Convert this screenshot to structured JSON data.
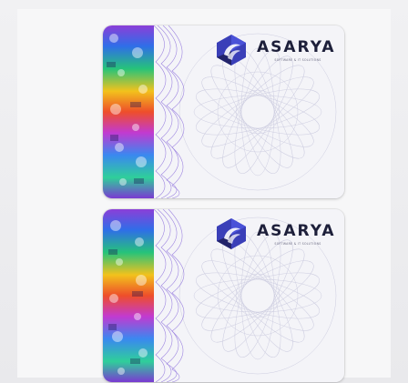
{
  "cards": [
    {
      "brand": "ASARYA",
      "tagline": "SOFTWARE & IT SOLUTIONS",
      "logo": "asarya-logo-icon"
    },
    {
      "brand": "ASARYA",
      "tagline": "SOFTWARE & IT SOLUTIONS",
      "logo": "asarya-logo-icon"
    }
  ],
  "colors": {
    "logo_blue": "#3a3fb8",
    "logo_dark": "#22236a",
    "brand_text": "#1d1f3a",
    "guilloche_line": "#c9c9d8",
    "hologram_purple": "#6b3fd1"
  }
}
